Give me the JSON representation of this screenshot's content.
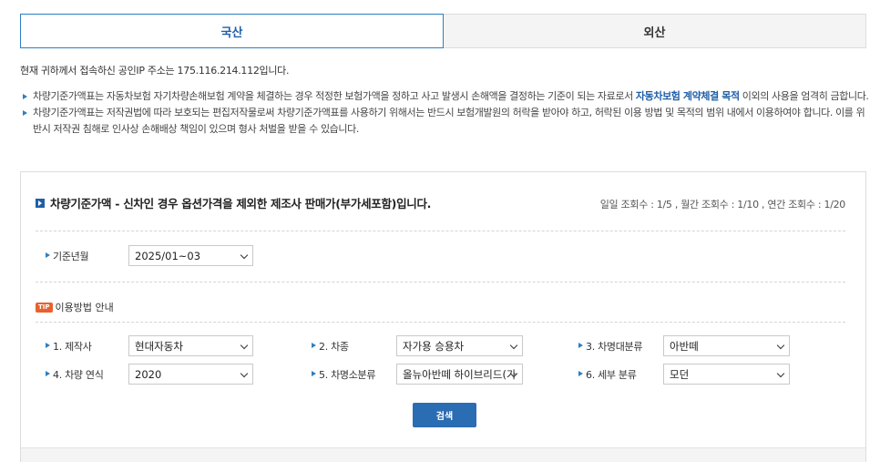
{
  "tabs": [
    {
      "label": "국산",
      "active": true
    },
    {
      "label": "외산",
      "active": false
    }
  ],
  "ip_notice": "현재 귀하께서 접속하신 공인IP 주소는 175.116.214.112입니다.",
  "notes": {
    "note1_before": "차량기준가액표는 자동차보험 자기차량손해보험 계약을 체결하는 경우 적정한 보험가액을 정하고 사고 발생시 손해액을 결정하는 기준이 되는 자료로서 ",
    "note1_highlight": "자동차보험 계약체결 목적",
    "note1_after": " 이외의 사용을 엄격히 금합니다.",
    "note2": "차량기준가액표는 저작권법에 따라 보호되는 편집저작물로써 차량기준가액표를 사용하기 위해서는 반드시 보험개발원의 허락을 받아야 하고, 허락된 이용 방법 및 목적의 범위 내에서 이용하여야 합니다. 이를 위반시 저작권 침해로 인사상 손해배상 책임이 있으며 형사 처벌을 받을 수 있습니다."
  },
  "panel": {
    "heading": "차량기준가액 - 신차인 경우 옵션가격을 제외한 제조사 판매가(부가세포함)입니다.",
    "counts": "일일 조회수 : 1/5 , 월간 조회수 : 1/10 , 연간 조회수 : 1/20",
    "base_month_label": "기준년월",
    "base_month_value": "2025/01~03",
    "tip_badge": "TIP",
    "tip_label": "이용방법 안내",
    "fields": {
      "maker_label": "1. 제작사",
      "maker_value": "현대자동차",
      "type_label": "2. 차종",
      "type_value": "자가용 승용차",
      "model_major_label": "3. 차명대분류",
      "model_major_value": "아반떼",
      "year_label": "4. 차량 연식",
      "year_value": "2020",
      "model_minor_label": "5. 차명소분류",
      "model_minor_value": "올뉴아반떼 하이브리드(가",
      "detail_label": "6. 세부 분류",
      "detail_value": "모던"
    },
    "search_label": "검색"
  },
  "colors": {
    "accent": "#1f5fa8",
    "button": "#2a6db3",
    "tip_badge": "#e8612c"
  }
}
